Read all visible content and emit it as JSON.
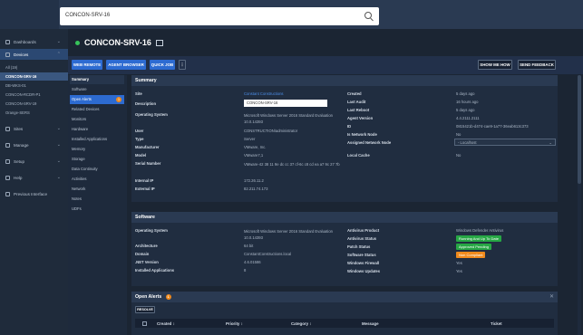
{
  "search": {
    "value": "CONCON-SRV-16"
  },
  "sidebar": {
    "items": [
      {
        "label": "Dashboards"
      },
      {
        "label": "Devices"
      },
      {
        "label": "Sites"
      },
      {
        "label": "Manage"
      },
      {
        "label": "Setup"
      },
      {
        "label": "Help"
      },
      {
        "label": "Previous Interface"
      }
    ],
    "sub": [
      "All (19)",
      "CONCON-SRV-16",
      "DB-WKS-01",
      "CONCON-RCDR-P1",
      "CONCON-SRV-19",
      "Orange-SERS"
    ]
  },
  "header": {
    "title": "CONCON-SRV-16"
  },
  "toolbar": {
    "web_remote": "WEB REMOTE",
    "agent_browser": "AGENT BROWSER",
    "quick_job": "QUICK JOB",
    "more": "⋮",
    "show_me_how": "SHOW ME HOW",
    "send_feedback": "SEND FEEDBACK"
  },
  "leftnav": {
    "items": [
      "Summary",
      "Software",
      "Open Alerts",
      "Related Devices",
      "Monitors",
      "Hardware",
      "Installed Applications",
      "Memory",
      "Storage",
      "Data Continuity",
      "Activities",
      "Network",
      "Notes",
      "UDFs"
    ],
    "alerts_badge": "1"
  },
  "summary": {
    "heading": "Summary",
    "left": [
      {
        "label": "Site",
        "value": "Constant Constructions"
      },
      {
        "label": "Description",
        "value": "CONCON-SRV-16"
      },
      {
        "label": "Operating System",
        "value": "Microsoft Windows Server 2016 Standard Evaluation 10.0.14393"
      },
      {
        "label": "User",
        "value": "CONSTRUCTION\\administrator"
      },
      {
        "label": "Type",
        "value": "Server"
      },
      {
        "label": "Manufacturer",
        "value": "VMware, Inc."
      },
      {
        "label": "Model",
        "value": "VMware7,1"
      },
      {
        "label": "Serial Number",
        "value": "VMware-42 38 11 9e dc cc 37 cf-6c c8 cd ea a7 9c 27 7b"
      },
      {
        "label": "Internal IP",
        "value": "172.26.11.2"
      },
      {
        "label": "External IP",
        "value": "82.211.74.173"
      }
    ],
    "right": [
      {
        "label": "Created",
        "value": "5 days ago"
      },
      {
        "label": "Last Audit",
        "value": "16 hours ago"
      },
      {
        "label": "Last Reboot",
        "value": "5 days ago"
      },
      {
        "label": "Agent Version",
        "value": "4.4.2111.2111"
      },
      {
        "label": "ID",
        "value": "0815421b-d474-cae9-1a77-36eab613c373"
      },
      {
        "label": "Is Network Node",
        "value": "No"
      },
      {
        "label": "Assigned Network Node",
        "value": "- Localhost"
      },
      {
        "label": "Local Cache",
        "value": "No"
      }
    ]
  },
  "software": {
    "heading": "Software",
    "left": [
      {
        "label": "Operating System",
        "value": "Microsoft Windows Server 2016 Standard Evaluation 10.0.14393"
      },
      {
        "label": "Architecture",
        "value": "64 bit"
      },
      {
        "label": "Domain",
        "value": "ConstantConstructions.local"
      },
      {
        "label": ".NET Version",
        "value": "4.6.01586"
      },
      {
        "label": "Installed Applications",
        "value": "8"
      }
    ],
    "right": [
      {
        "label": "Antivirus Product",
        "value": "Windows Defender Antivirus"
      },
      {
        "label": "Antivirus Status",
        "value": "Running And Up To Date"
      },
      {
        "label": "Patch Status",
        "value": "Approved Pending"
      },
      {
        "label": "Software Status",
        "value": "Non Compliant"
      },
      {
        "label": "Windows Firewall",
        "value": "Yes"
      },
      {
        "label": "Windows Updates",
        "value": "Yes"
      }
    ]
  },
  "alerts": {
    "heading": "Open Alerts",
    "count": "1",
    "button": "RESOLVE",
    "columns": [
      "Created ↕",
      "Priority ↕",
      "Category ↕",
      "Message",
      "Ticket"
    ]
  },
  "colors": {
    "accent": "#2d6bd1",
    "green": "#27a745",
    "orange": "#f08a1c"
  }
}
